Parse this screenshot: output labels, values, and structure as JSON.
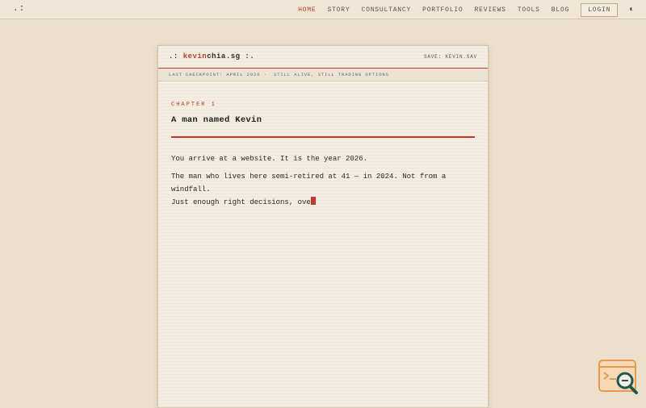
{
  "brand": ".:",
  "nav": {
    "items": [
      "HOME",
      "STORY",
      "CONSULTANCY",
      "PORTFOLIO",
      "REVIEWS",
      "TOOLS",
      "BLOG"
    ],
    "active_index": 0,
    "login": "LOGIN",
    "theme_icon": "◐"
  },
  "card": {
    "title_prefix": ".: ",
    "title_red": "kevin",
    "title_rest": "chia.sg :.",
    "save": "SAVE: KEVIN.SAV",
    "status_left": "LAST CHECKPOINT: APRIL 2026",
    "status_sep": "·",
    "status_right": "STILL ALIVE, STILL TRADING OPTIONS",
    "chapter": "CHAPTER 1",
    "chapter_title": "A man named Kevin",
    "paragraph1": "You arrive at a website. It is the year 2026.",
    "paragraph2_line1": "The man who lives here semi-retired at 41 — in 2024. Not from a windfall.",
    "paragraph2_line2": "Just enough right decisions, ove"
  },
  "colors": {
    "accent": "#c0392b",
    "background": "#ecdfcb",
    "paper": "#f3ede2"
  },
  "widget": {
    "icon": "search-widget-icon"
  }
}
